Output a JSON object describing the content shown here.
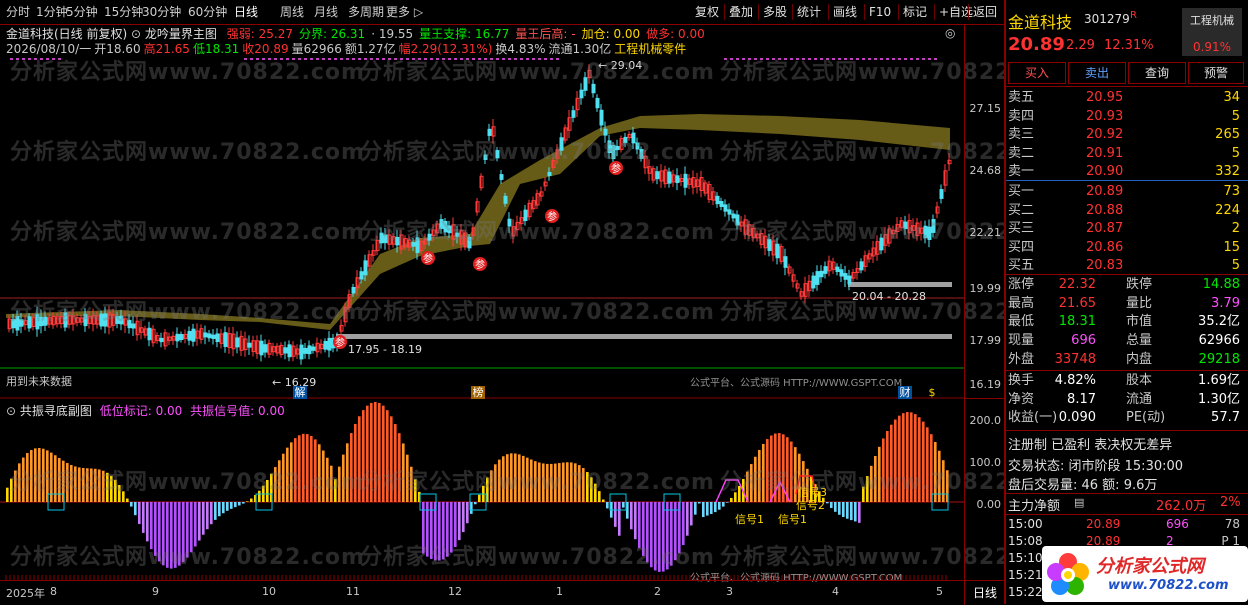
{
  "toolbar": {
    "left_items": [
      "分时",
      "1分钟",
      "5分钟",
      "15分钟",
      "30分钟",
      "60分钟",
      "日线",
      "周线",
      "月线",
      "多周期",
      "更多 ▷"
    ],
    "active_item": "日线",
    "right_items": [
      "复权",
      "叠加",
      "多股",
      "统计",
      "画线",
      "F10",
      "标记",
      "+自选",
      "返回"
    ]
  },
  "main_chart": {
    "header_line1_name": "金道科技(日线 前复权)",
    "indicator_title": "龙吟量界主图",
    "indicator_values": [
      {
        "label": "强弱: 25.27",
        "color": "#ff3232"
      },
      {
        "label": "分界: 26.31",
        "color": "#00e600"
      },
      {
        "label": "· 19.55",
        "color": "#c8c8c8"
      },
      {
        "label": "量王支撑: 16.77",
        "color": "#00e600"
      },
      {
        "label": "量王后高: -",
        "color": "#ff5050"
      },
      {
        "label": "加仓: 0.00",
        "color": "#ffd800"
      },
      {
        "label": "做多: 0.00",
        "color": "#ff3232"
      }
    ],
    "header_line2": [
      {
        "text": "2026/08/10/一",
        "color": "#c8c8c8"
      },
      {
        "text": "开18.60",
        "color": "#c8c8c8"
      },
      {
        "text": "高21.65",
        "color": "#ff3232"
      },
      {
        "text": "低18.31",
        "color": "#00e600"
      },
      {
        "text": "收20.89",
        "color": "#ff3232"
      },
      {
        "text": "量62966",
        "color": "#c8c8c8"
      },
      {
        "text": "额1.27亿",
        "color": "#c8c8c8"
      },
      {
        "text": "幅2.29(12.31%)",
        "color": "#ff3232"
      },
      {
        "text": "换4.83%",
        "color": "#c8c8c8"
      },
      {
        "text": "流通1.30亿",
        "color": "#c8c8c8"
      },
      {
        "text": "工程机械零件",
        "color": "#ffd800"
      }
    ],
    "annotations": {
      "high_mark": "29.04",
      "low_mark": "16.29",
      "range1": "17.95 - 18.19",
      "range2": "20.04 - 20.28",
      "future_data": "用到未来数据",
      "platform": "公式平台、公式源码 HTTP://WWW.GSPT.COM",
      "tag_jie": "解",
      "tag_bang": "榜",
      "tag_cai": "财",
      "tag_dollar": "$",
      "can_label": "参"
    },
    "y_ticks": [
      "27.15",
      "24.68",
      "22.21",
      "19.99",
      "17.99",
      "16.19"
    ]
  },
  "sub_chart": {
    "title": "共振寻底副图",
    "low_mark_label": "低位标记: 0.00",
    "signal_label": "共振信号值: 0.00",
    "y_ticks": [
      "200.0",
      "100.0",
      "0.00"
    ],
    "signals": [
      "信号1",
      "信号1",
      "信号2",
      "信号3"
    ]
  },
  "x_axis": {
    "ticks": [
      "2025年",
      "8",
      "9",
      "10",
      "11",
      "12",
      "1",
      "2",
      "3",
      "4",
      "5"
    ],
    "period": "日线"
  },
  "watermarks": [
    "分析家公式网www.70822.com"
  ],
  "panel": {
    "stock_name": "金道科技",
    "stock_code": "301279",
    "r_mark": "R",
    "industry": "工程机械",
    "industry_pct": "0.91%",
    "last_price": "20.89",
    "change": "2.29",
    "change_pct": "12.31%",
    "buttons": [
      "买入",
      "卖出",
      "查询",
      "预警"
    ],
    "asks": [
      {
        "label": "卖五",
        "price": "20.95",
        "vol": "34"
      },
      {
        "label": "卖四",
        "price": "20.93",
        "vol": "5"
      },
      {
        "label": "卖三",
        "price": "20.92",
        "vol": "265"
      },
      {
        "label": "卖二",
        "price": "20.91",
        "vol": "5"
      },
      {
        "label": "卖一",
        "price": "20.90",
        "vol": "332"
      }
    ],
    "bids": [
      {
        "label": "买一",
        "price": "20.89",
        "vol": "73"
      },
      {
        "label": "买二",
        "price": "20.88",
        "vol": "224"
      },
      {
        "label": "买三",
        "price": "20.87",
        "vol": "2"
      },
      {
        "label": "买四",
        "price": "20.86",
        "vol": "15"
      },
      {
        "label": "买五",
        "price": "20.83",
        "vol": "5"
      }
    ],
    "stats": [
      {
        "l1": "涨停",
        "v1": "22.32",
        "c1": "#ff3232",
        "l2": "跌停",
        "v2": "14.88",
        "c2": "#00e600"
      },
      {
        "l1": "最高",
        "v1": "21.65",
        "c1": "#ff3232",
        "l2": "量比",
        "v2": "3.79",
        "c2": "#ff50ff"
      },
      {
        "l1": "最低",
        "v1": "18.31",
        "c1": "#00e600",
        "l2": "市值",
        "v2": "35.2亿",
        "c2": "#ffffff"
      },
      {
        "l1": "现量",
        "v1": "696",
        "c1": "#ff50ff",
        "l2": "总量",
        "v2": "62966",
        "c2": "#ffffff"
      },
      {
        "l1": "外盘",
        "v1": "33748",
        "c1": "#ff3232",
        "l2": "内盘",
        "v2": "29218",
        "c2": "#00e600"
      }
    ],
    "stats2": [
      {
        "l1": "换手",
        "v1": "4.82%",
        "c1": "#ffffff",
        "l2": "股本",
        "v2": "1.69亿",
        "c2": "#ffffff"
      },
      {
        "l1": "净资",
        "v1": "8.17",
        "c1": "#ffffff",
        "l2": "流通",
        "v2": "1.30亿",
        "c2": "#ffffff"
      },
      {
        "l1": "收益(一)",
        "v1": "0.090",
        "c1": "#ffffff",
        "l2": "PE(动)",
        "v2": "57.7",
        "c2": "#ffffff"
      }
    ],
    "reg_line": "注册制 已盈利 表决权无差异",
    "trade_state": "交易状态: 闭市阶段 15:30:00",
    "after_hours": "盘后交易量: 46  额: 9.6万",
    "main_net_label": "主力净额",
    "main_net_value": "262.0万",
    "main_net_pct": "2%",
    "ticks": [
      {
        "time": "15:00",
        "price": "20.89",
        "vol": "696",
        "n": "78"
      },
      {
        "time": "15:08",
        "price": "20.89",
        "vol": "2",
        "n": "P 1"
      },
      {
        "time": "15:10",
        "price": "",
        "vol": "",
        "n": ""
      },
      {
        "time": "15:21",
        "price": "",
        "vol": "",
        "n": ""
      },
      {
        "time": "15:22",
        "price": "",
        "vol": "",
        "n": ""
      }
    ],
    "logo_text": "分析家公式网",
    "logo_url": "www.70822.com"
  }
}
